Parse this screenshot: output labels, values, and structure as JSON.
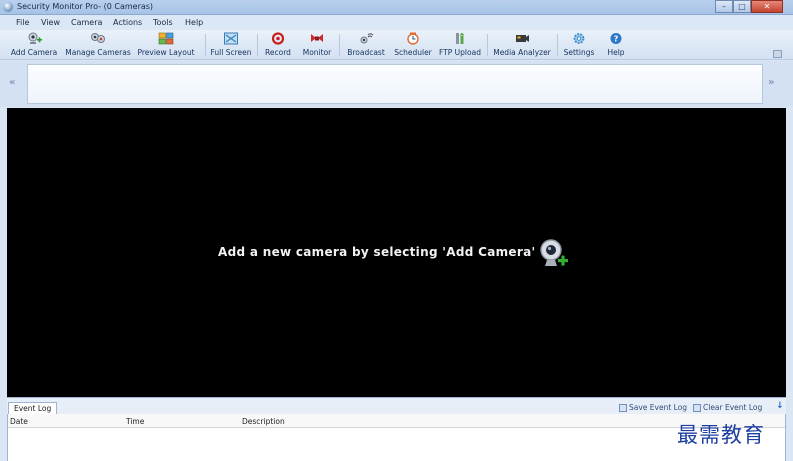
{
  "window": {
    "title": "Security Monitor Pro- (0 Cameras)",
    "controls": {
      "minimize": "–",
      "maximize": "□",
      "close": "✕"
    }
  },
  "menu": [
    "File",
    "View",
    "Camera",
    "Actions",
    "Tools",
    "Help"
  ],
  "toolbar": {
    "buttons": [
      {
        "label": "Add Camera",
        "icon": "add-camera-icon"
      },
      {
        "label": "Manage Cameras",
        "icon": "manage-cameras-icon"
      },
      {
        "label": "Preview Layout",
        "icon": "preview-layout-icon"
      },
      {
        "label": "Full Screen",
        "icon": "full-screen-icon"
      },
      {
        "label": "Record",
        "icon": "record-icon"
      },
      {
        "label": "Monitor",
        "icon": "monitor-icon"
      },
      {
        "label": "Broadcast",
        "icon": "broadcast-icon"
      },
      {
        "label": "Scheduler",
        "icon": "scheduler-icon"
      },
      {
        "label": "FTP Upload",
        "icon": "ftp-upload-icon"
      },
      {
        "label": "Media Analyzer",
        "icon": "media-analyzer-icon"
      },
      {
        "label": "Settings",
        "icon": "settings-icon"
      },
      {
        "label": "Help",
        "icon": "help-icon"
      }
    ]
  },
  "nav": {
    "left": "«",
    "right": "»"
  },
  "viewer": {
    "message": "Add a new camera by selecting 'Add Camera'"
  },
  "event_log": {
    "tab": "Event Log",
    "save_label": "Save Event Log",
    "clear_label": "Clear Event Log",
    "columns": [
      "Date",
      "Time",
      "Description"
    ]
  },
  "watermark": "最需教育",
  "colors": {
    "viewer_bg": "#000000",
    "chrome_bg": "#dbe6f4",
    "title_bar": "#b9d1ee",
    "watermark": "#1e3fa0"
  }
}
